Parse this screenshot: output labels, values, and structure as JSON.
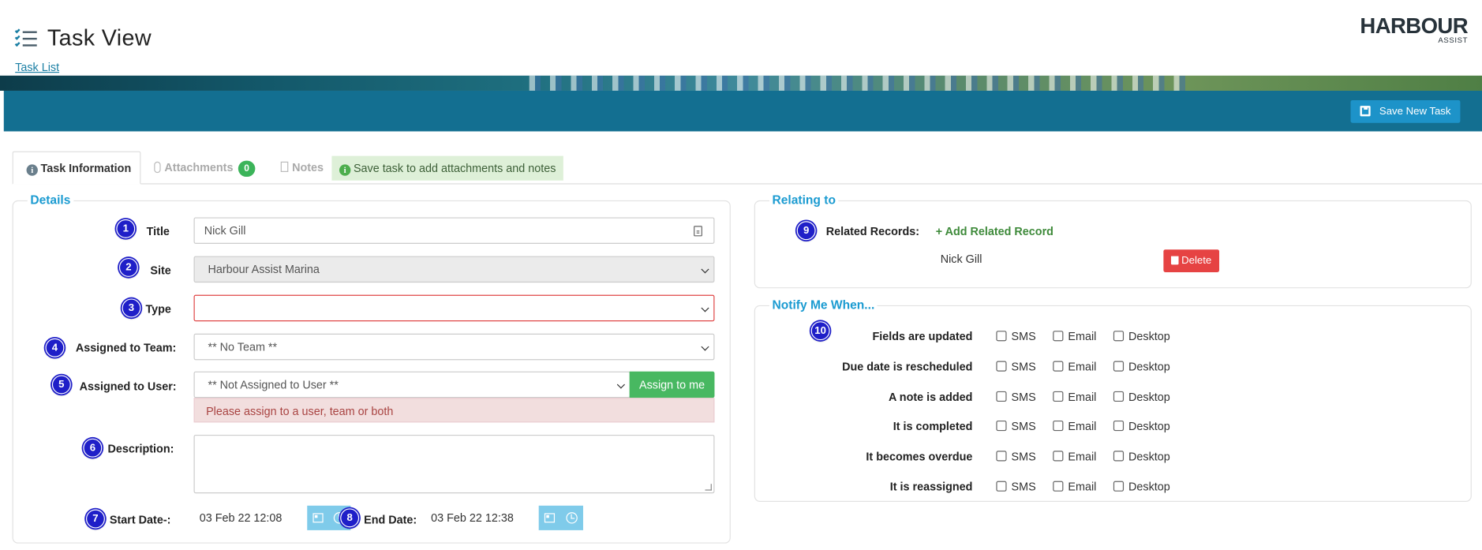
{
  "header": {
    "title": "Task View",
    "breadcrumb": "Task List",
    "logo_main": "HARBOUR",
    "logo_sub": "ASSIST"
  },
  "toolbar": {
    "save_label": "Save New Task"
  },
  "tabs": {
    "task_info": "Task Information",
    "attachments": "Attachments",
    "attachments_count": "0",
    "notes": "Notes",
    "notice": "Save task to add attachments and notes"
  },
  "details": {
    "legend": "Details",
    "numbers": [
      "1",
      "2",
      "3",
      "4",
      "5",
      "6",
      "7",
      "8"
    ],
    "title_label": "Title",
    "title_value": "Nick Gill",
    "site_label": "Site",
    "site_value": "Harbour Assist Marina",
    "type_label": "Type",
    "type_value": "",
    "team_label": "Assigned to Team:",
    "team_value": "** No Team **",
    "user_label": "Assigned to User:",
    "user_value": "** Not Assigned to User **",
    "assign_me": "Assign to me",
    "assign_error": "Please assign to a user, team or both",
    "description_label": "Description:",
    "start_label": "Start Date-:",
    "start_value": "03 Feb 22 12:08",
    "end_label": "End Date:",
    "end_value": "03 Feb 22 12:38"
  },
  "relating": {
    "legend": "Relating to",
    "number": "9",
    "related_label": "Related Records:",
    "add_label": "+ Add Related Record",
    "record_name": "Nick Gill",
    "delete_label": "Delete"
  },
  "notify": {
    "legend": "Notify Me When...",
    "number": "10",
    "option_labels": [
      "SMS",
      "Email",
      "Desktop"
    ],
    "rows": [
      "Fields are updated",
      "Due date is rescheduled",
      "A note is added",
      "It is completed",
      "It becomes overdue",
      "It is reassigned"
    ]
  }
}
